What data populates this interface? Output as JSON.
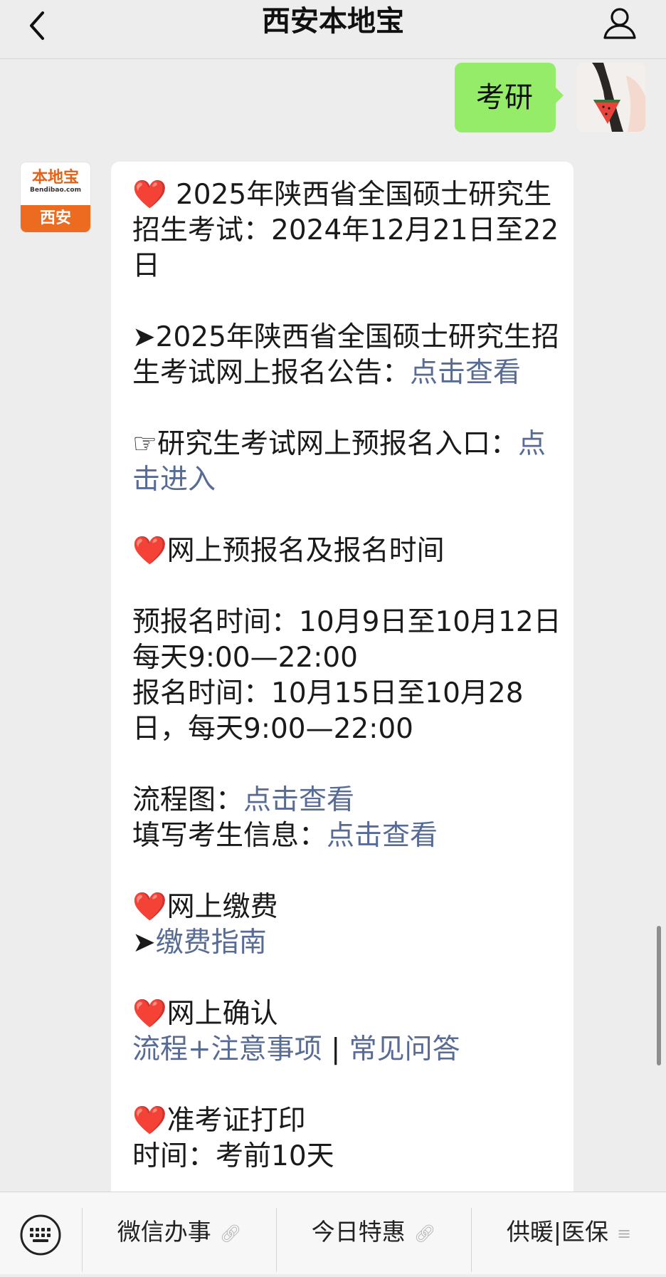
{
  "header": {
    "title": "西安本地宝",
    "back_icon": "chevron-left-icon",
    "profile_icon": "person-icon"
  },
  "user_message": {
    "text": "考研"
  },
  "bot_avatar": {
    "logo_name": "本地宝",
    "logo_domain": "Bendibao.com",
    "logo_city": "西安"
  },
  "message": {
    "heart": "❤️",
    "exam_title": " 2025年陕西省全国硕士研究生招生考试：2024年12月21日至22日",
    "announcement_prefix": "➤2025年陕西省全国硕士研究生招生考试网上报名公告：",
    "announcement_link": "点击查看",
    "prereg_prefix": "☞研究生考试网上预报名入口：",
    "prereg_link": "点击进入",
    "section_time": "网上预报名及报名时间",
    "prereg_time": "预报名时间：10月9日至10月12日每天9:00—22:00",
    "reg_time": "报名时间：10月15日至10月28日，每天9:00—22:00",
    "flow_label": "流程图：",
    "flow_link": "点击查看",
    "fill_label": "填写考生信息：",
    "fill_link": "点击查看",
    "section_pay": "网上缴费",
    "pay_arrow": "➤",
    "pay_link": "缴费指南",
    "section_confirm": "网上确认",
    "confirm_link1": "流程+注意事项",
    "confirm_sep": " | ",
    "confirm_link2": "常见问答",
    "section_admit": "准考证打印",
    "admit_partial": "时间：考前10天"
  },
  "bottom_menu": {
    "keyboard_icon": "keyboard-icon",
    "items": [
      {
        "label": "微信办事",
        "icon": "link-icon"
      },
      {
        "label": "今日特惠",
        "icon": "link-icon"
      },
      {
        "label": "供暖|医保",
        "icon": "menu-icon"
      }
    ]
  },
  "colors": {
    "user_bubble": "#95ec69",
    "link": "#576b95",
    "background": "#ededed",
    "heart": "#e0242b"
  }
}
